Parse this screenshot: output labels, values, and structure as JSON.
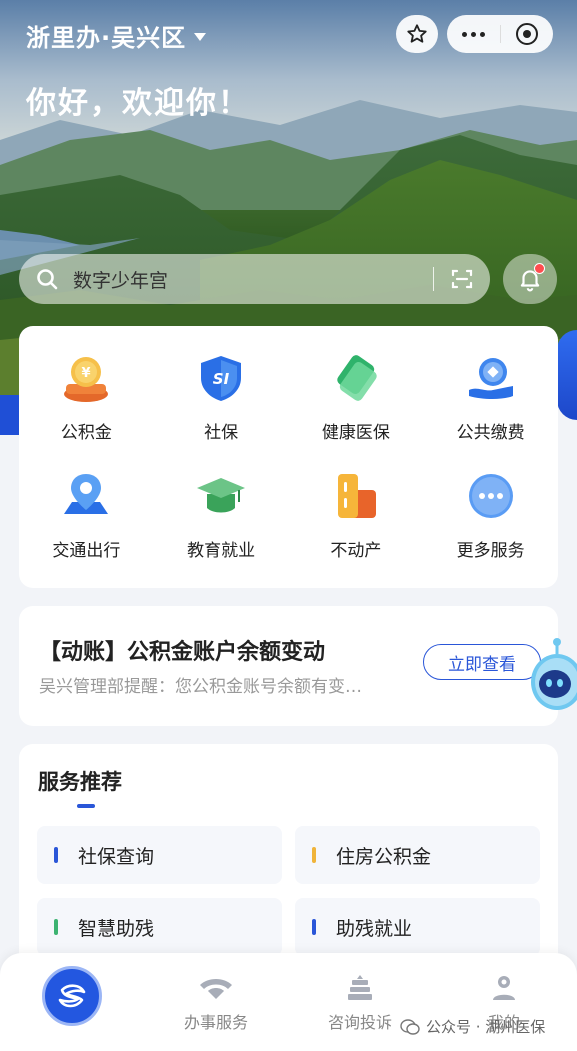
{
  "header": {
    "city": "浙里办·吴兴区",
    "greeting": "你好，欢迎你！"
  },
  "search": {
    "placeholder": "数字少年宫"
  },
  "services": [
    {
      "label": "公积金",
      "icon": "fund-icon"
    },
    {
      "label": "社保",
      "icon": "social-security-icon"
    },
    {
      "label": "健康医保",
      "icon": "health-insurance-icon"
    },
    {
      "label": "公共缴费",
      "icon": "public-payment-icon"
    },
    {
      "label": "交通出行",
      "icon": "transport-icon"
    },
    {
      "label": "教育就业",
      "icon": "education-icon"
    },
    {
      "label": "不动产",
      "icon": "real-estate-icon"
    },
    {
      "label": "更多服务",
      "icon": "more-services-icon"
    }
  ],
  "notice": {
    "title": "【动账】公积金账户余额变动",
    "subtitle": "吴兴管理部提醒：您公积金账号余额有变…",
    "button": "立即查看"
  },
  "recommend": {
    "heading": "服务推荐",
    "items": [
      {
        "label": "社保查询",
        "color": "#2a56d8"
      },
      {
        "label": "住房公积金",
        "color": "#f0b43a"
      },
      {
        "label": "智慧助残",
        "color": "#3cb371"
      },
      {
        "label": "助残就业",
        "color": "#2a56d8"
      }
    ]
  },
  "tabbar": {
    "tabs": [
      {
        "label": "办事服务"
      },
      {
        "label": "咨询投诉"
      },
      {
        "label": "我的"
      }
    ]
  },
  "watermark": "公众号 · 湖州医保",
  "colors": {
    "accent": "#2a56d8",
    "badge": "#ff4d4f"
  }
}
